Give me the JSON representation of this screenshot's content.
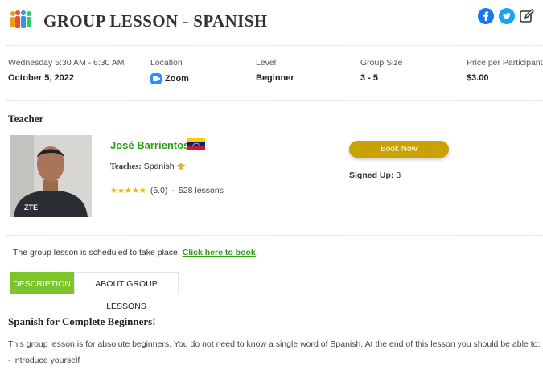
{
  "header": {
    "title": "GROUP LESSON - SPANISH",
    "logo_icon": "group-people-icon",
    "social": [
      "facebook-icon",
      "twitter-icon",
      "edit-icon"
    ],
    "colors": {
      "facebook": "#1877f2",
      "twitter": "#1da1f2"
    }
  },
  "info": {
    "date_label": "Wednesday 5:30 AM - 6:30 AM",
    "date_value": "October 5, 2022",
    "location_label": "Location",
    "location_value": "Zoom",
    "level_label": "Level",
    "level_value": "Beginner",
    "size_label": "Group Size",
    "size_value": "3 - 5",
    "price_label": "Price per Participant",
    "price_value": "$3.00"
  },
  "teacher": {
    "heading": "Teacher",
    "name": "José Barrientos",
    "flag": "venezuela-flag",
    "teaches_label": "Teaches:",
    "teaches_value": "Spanish",
    "stars": 5,
    "rating": "(5.0)",
    "sep": "-",
    "lessons": "528 lessons",
    "shirt_text": "ZTE"
  },
  "booking": {
    "button": "Book Now",
    "signed_label": "Signed Up:",
    "signed_value": "3",
    "accent": "#c9a100"
  },
  "notice": {
    "text": "The group lesson is scheduled to take place.",
    "link": "Click here to book",
    "end": "."
  },
  "tabs": [
    {
      "label": "DESCRIPTION",
      "active": true
    },
    {
      "label": "ABOUT GROUP LESSONS",
      "active": false
    }
  ],
  "tab_active_color": "#7cc62c",
  "description": {
    "title": "Spanish for Complete Beginners!",
    "body": "This group lesson is for absolute beginners. You do not need to know a single word of Spanish. At the end of this lesson you should be able to:",
    "bullet": "- introduce yourself"
  }
}
